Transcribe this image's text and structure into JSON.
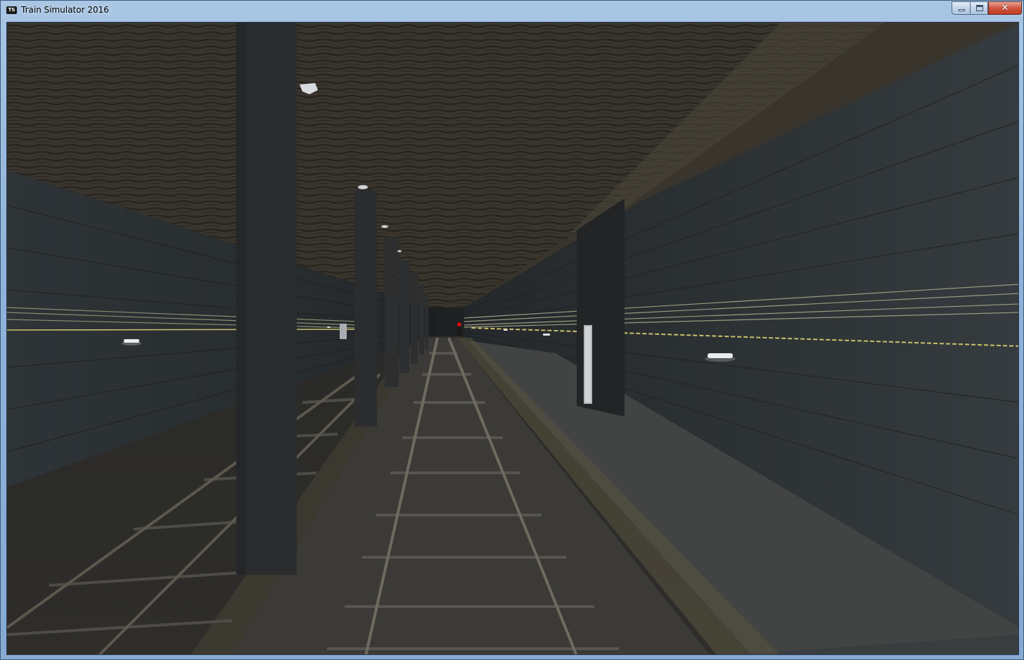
{
  "window": {
    "title": "Train Simulator 2016",
    "icon_label": "TS",
    "controls": {
      "minimize": "minimize-icon",
      "maximize": "maximize-icon",
      "close": "close-icon",
      "close_glyph": "✕"
    }
  },
  "colors": {
    "titlebar": "#9dbde0",
    "close_button": "#c9442c",
    "ceiling": "#3a352c",
    "wall": "#2b3033",
    "signal_red": "#d01010",
    "cable_yellow": "#c9c06a"
  }
}
